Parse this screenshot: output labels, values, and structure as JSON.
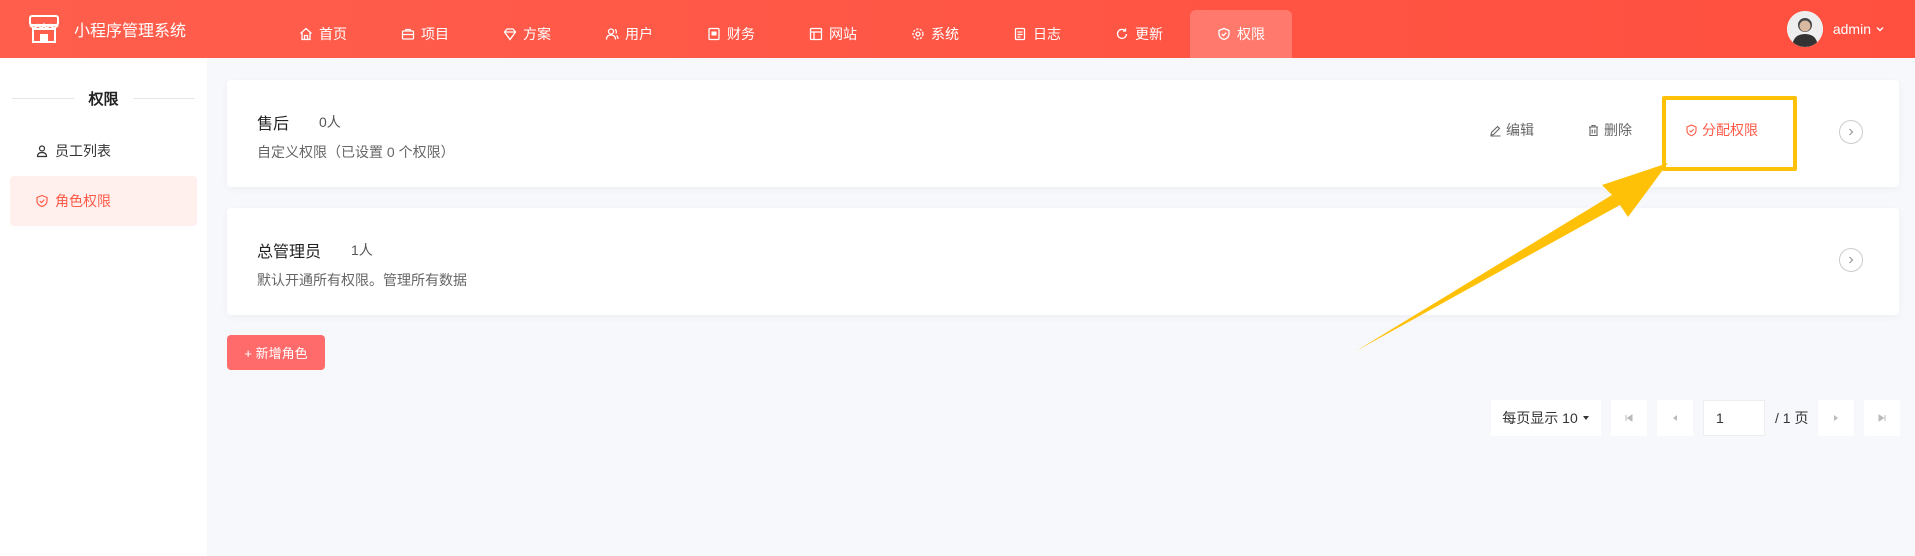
{
  "app": {
    "title": "小程序管理系统"
  },
  "nav": [
    {
      "label": "首页",
      "icon": "home-icon"
    },
    {
      "label": "项目",
      "icon": "briefcase-icon"
    },
    {
      "label": "方案",
      "icon": "diamond-icon"
    },
    {
      "label": "用户",
      "icon": "users-icon"
    },
    {
      "label": "财务",
      "icon": "finance-icon"
    },
    {
      "label": "网站",
      "icon": "layout-icon"
    },
    {
      "label": "系统",
      "icon": "gear-icon"
    },
    {
      "label": "日志",
      "icon": "document-icon"
    },
    {
      "label": "更新",
      "icon": "refresh-icon"
    },
    {
      "label": "权限",
      "icon": "shield-icon",
      "active": true
    }
  ],
  "user": {
    "name": "admin"
  },
  "sidebar": {
    "title": "权限",
    "items": [
      {
        "label": "员工列表",
        "icon": "person-icon"
      },
      {
        "label": "角色权限",
        "icon": "shield-icon",
        "active": true
      }
    ]
  },
  "roles": [
    {
      "name": "售后",
      "count": "0人",
      "desc": "自定义权限（已设置 0 个权限）",
      "actions": {
        "edit": "编辑",
        "delete": "删除",
        "assign": "分配权限"
      }
    },
    {
      "name": "总管理员",
      "count": "1人",
      "desc": "默认开通所有权限。管理所有数据"
    }
  ],
  "add_role_label": "+ 新增角色",
  "pagination": {
    "per_page_label": "每页显示 10",
    "current_page": "1",
    "total_label": "/ 1 页"
  },
  "colors": {
    "brand": "#ff5a48",
    "highlight": "#ffc107",
    "add_button": "#ff6b6b"
  }
}
